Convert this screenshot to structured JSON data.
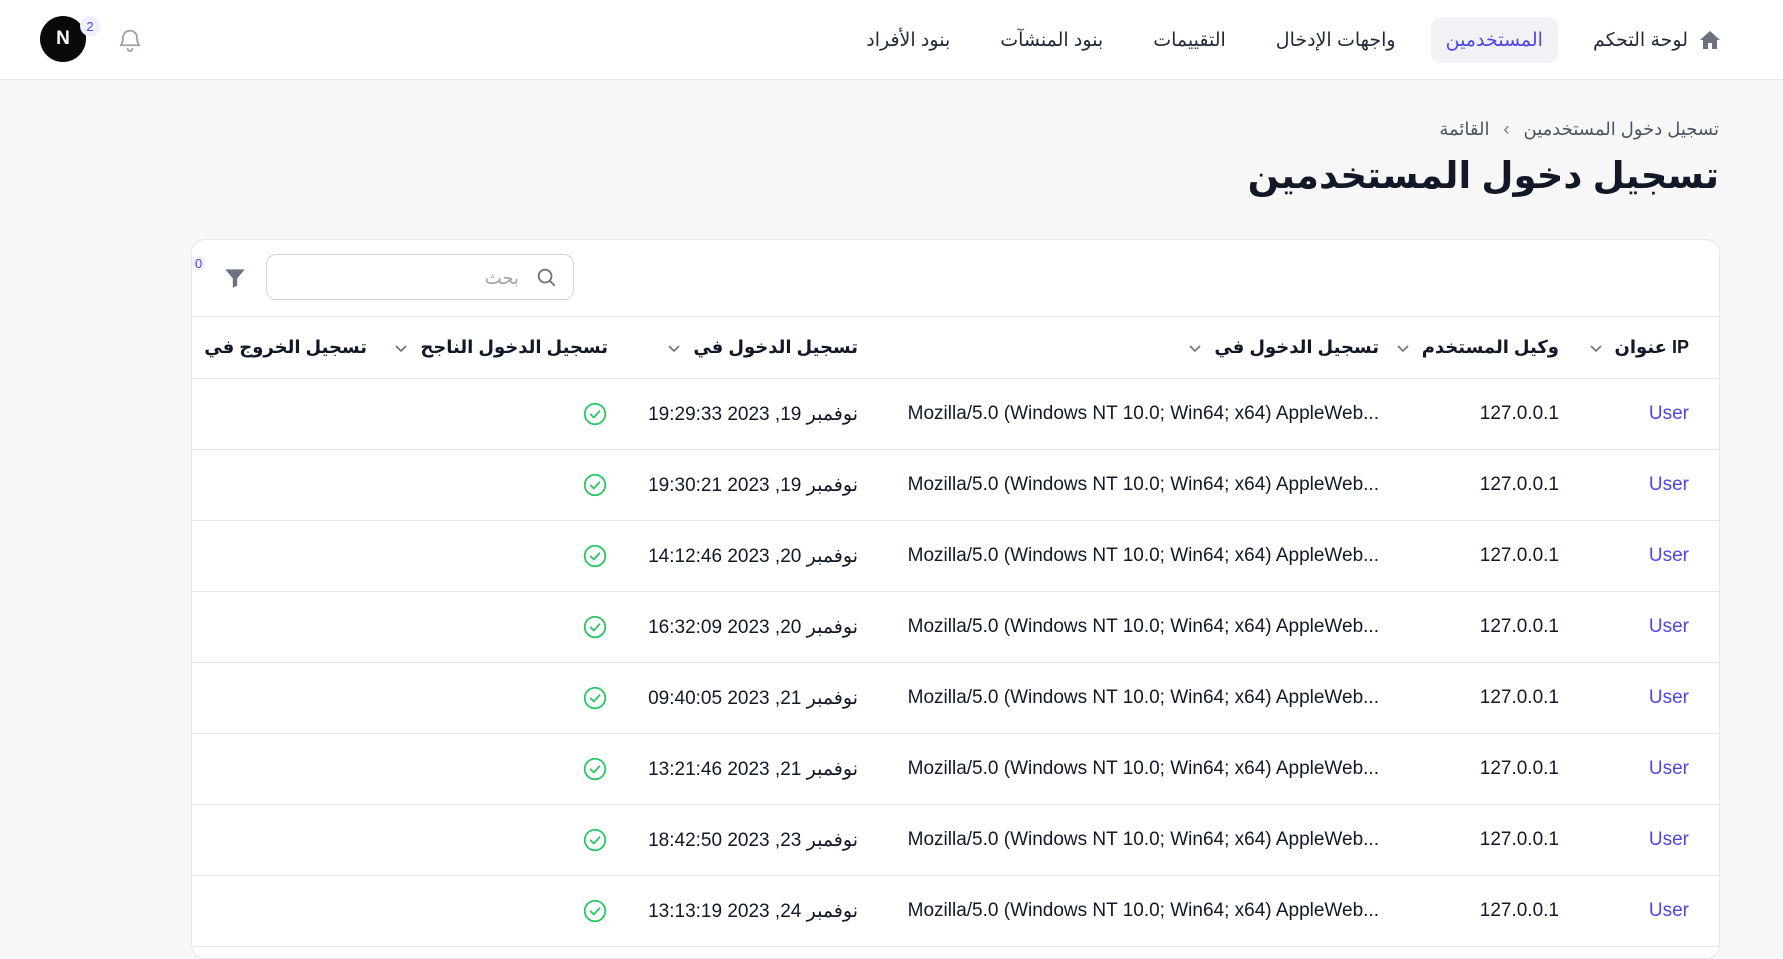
{
  "nav": {
    "items": [
      {
        "label": "لوحة التحكم",
        "icon": "home-icon"
      },
      {
        "label": "المستخدمين",
        "active": true
      },
      {
        "label": "واجهات الإدخال"
      },
      {
        "label": "التقييمات"
      },
      {
        "label": "بنود المنشآت"
      },
      {
        "label": "بنود الأفراد"
      }
    ]
  },
  "user": {
    "initial": "N",
    "notification_count": "2"
  },
  "breadcrumb": {
    "current": "تسجيل دخول المستخدمين",
    "list": "القائمة"
  },
  "page_title": "تسجيل دخول المستخدمين",
  "toolbar": {
    "search_placeholder": "بحث",
    "filter_count": "0"
  },
  "table": {
    "columns": [
      "عنوان IP",
      "وكيل المستخدم",
      "تسجيل الدخول في",
      "تسجيل الدخول في",
      "تسجيل الدخول الناجح",
      "تسجيل الخروج في"
    ],
    "rows": [
      {
        "user": "User",
        "ip": "127.0.0.1",
        "agent": "Mozilla/5.0 (Windows NT 10.0; Win64; x64) AppleWeb...",
        "login_at": "نوفمبر 19, 2023 19:29:33",
        "success": true,
        "logout_at": ""
      },
      {
        "user": "User",
        "ip": "127.0.0.1",
        "agent": "Mozilla/5.0 (Windows NT 10.0; Win64; x64) AppleWeb...",
        "login_at": "نوفمبر 19, 2023 19:30:21",
        "success": true,
        "logout_at": ""
      },
      {
        "user": "User",
        "ip": "127.0.0.1",
        "agent": "Mozilla/5.0 (Windows NT 10.0; Win64; x64) AppleWeb...",
        "login_at": "نوفمبر 20, 2023 14:12:46",
        "success": true,
        "logout_at": ""
      },
      {
        "user": "User",
        "ip": "127.0.0.1",
        "agent": "Mozilla/5.0 (Windows NT 10.0; Win64; x64) AppleWeb...",
        "login_at": "نوفمبر 20, 2023 16:32:09",
        "success": true,
        "logout_at": ""
      },
      {
        "user": "User",
        "ip": "127.0.0.1",
        "agent": "Mozilla/5.0 (Windows NT 10.0; Win64; x64) AppleWeb...",
        "login_at": "نوفمبر 21, 2023 09:40:05",
        "success": true,
        "logout_at": ""
      },
      {
        "user": "User",
        "ip": "127.0.0.1",
        "agent": "Mozilla/5.0 (Windows NT 10.0; Win64; x64) AppleWeb...",
        "login_at": "نوفمبر 21, 2023 13:21:46",
        "success": true,
        "logout_at": ""
      },
      {
        "user": "User",
        "ip": "127.0.0.1",
        "agent": "Mozilla/5.0 (Windows NT 10.0; Win64; x64) AppleWeb...",
        "login_at": "نوفمبر 23, 2023 18:42:50",
        "success": true,
        "logout_at": ""
      },
      {
        "user": "User",
        "ip": "127.0.0.1",
        "agent": "Mozilla/5.0 (Windows NT 10.0; Win64; x64) AppleWeb...",
        "login_at": "نوفمبر 24, 2023 13:13:19",
        "success": true,
        "logout_at": ""
      }
    ]
  },
  "colors": {
    "accent": "#4f46e5",
    "success": "#22c55e",
    "border": "#e5e7eb"
  }
}
